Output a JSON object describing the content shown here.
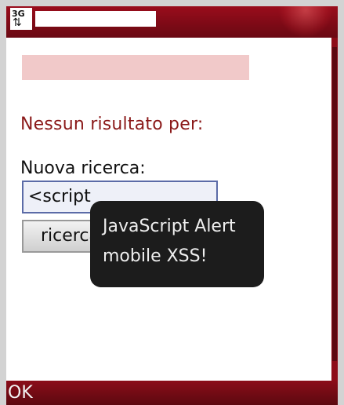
{
  "status_bar": {
    "network": "3G",
    "network_arrows": "⇅"
  },
  "page": {
    "no_result_text": "Nessun risultato per:",
    "new_search_label": "Nuova ricerca:",
    "search_input_value": "<script",
    "search_button_label": "ricerca"
  },
  "alert": {
    "line1": "JavaScript Alert",
    "line2": "mobile XSS!"
  },
  "softkeys": {
    "left": "OK"
  },
  "colors": {
    "brand_red": "#8b0d19",
    "input_border": "#5b6ba7",
    "alert_bg": "#1c1c1c"
  }
}
